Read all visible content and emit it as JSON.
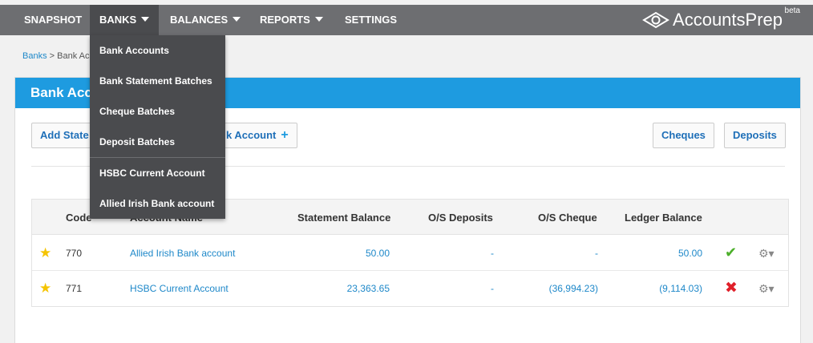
{
  "nav": {
    "items": [
      {
        "label": "SNAPSHOT"
      },
      {
        "label": "BANKS"
      },
      {
        "label": "BALANCES"
      },
      {
        "label": "REPORTS"
      },
      {
        "label": "SETTINGS"
      }
    ],
    "brand": "AccountsPrep",
    "beta": "beta"
  },
  "breadcrumb": {
    "link": "Banks",
    "separator": " > ",
    "current": "Bank Ac"
  },
  "panel": {
    "title": "Bank Acc"
  },
  "toolbar": {
    "add_statement": "Add State",
    "add_account": "k Account",
    "cheques": "Cheques",
    "deposits": "Deposits"
  },
  "table": {
    "headers": [
      "Code",
      "Account Name",
      "Statement Balance",
      "O/S Deposits",
      "O/S Cheque",
      "Ledger Balance"
    ],
    "rows": [
      {
        "code": "770",
        "name": "Allied Irish Bank account",
        "statement": "50.00",
        "deposits": "-",
        "cheque": "-",
        "ledger": "50.00",
        "status": "ok"
      },
      {
        "code": "771",
        "name": "HSBC Current Account",
        "statement": "23,363.65",
        "deposits": "-",
        "cheque": "(36,994.23)",
        "ledger": "(9,114.03)",
        "status": "error"
      }
    ]
  },
  "dropdown": {
    "items": [
      {
        "label": "Bank Accounts"
      },
      {
        "label": "Bank Statement Batches"
      },
      {
        "label": "Cheque Batches"
      },
      {
        "label": "Deposit Batches"
      },
      {
        "label": "HSBC Current Account"
      },
      {
        "label": "Allied Irish Bank account"
      }
    ]
  },
  "colors": {
    "nav": "#6d6e71",
    "nav_active": "#4a4b4e",
    "panel_header": "#1e9be0",
    "link": "#1e88c9"
  }
}
